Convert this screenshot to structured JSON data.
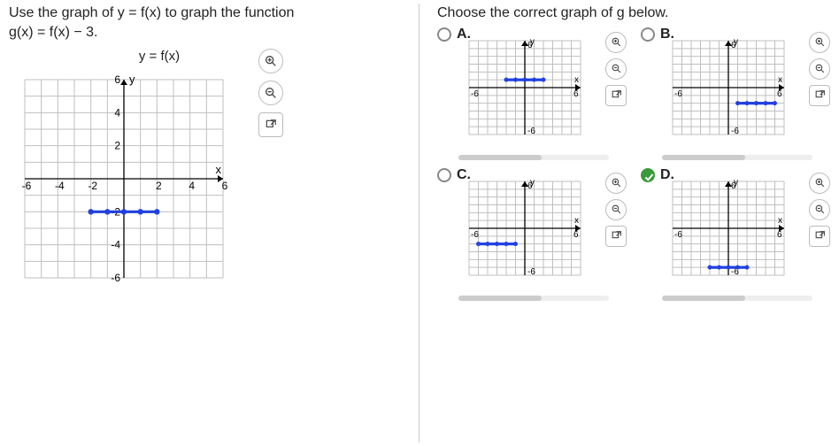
{
  "left": {
    "prompt_line1": "Use the graph of y = f(x) to graph the function",
    "prompt_line2": "g(x) = f(x) − 3.",
    "graph_title": "y = f(x)"
  },
  "right": {
    "prompt": "Choose the correct graph of g below.",
    "choices": {
      "A": {
        "label": "A."
      },
      "B": {
        "label": "B."
      },
      "C": {
        "label": "C."
      },
      "D": {
        "label": "D."
      }
    },
    "correct": "D"
  },
  "axis_labels": {
    "x": "x",
    "y": "y"
  },
  "icons": {
    "zoom_in": "zoom-in",
    "zoom_out": "zoom-out",
    "popout": "popout"
  },
  "chart_data": {
    "type": "line",
    "main": {
      "title": "y = f(x)",
      "xlabel": "x",
      "ylabel": "y",
      "xlim": [
        -6,
        6
      ],
      "ylim": [
        -6,
        6
      ],
      "x_ticks": [
        -6,
        -4,
        -2,
        2,
        4,
        6
      ],
      "y_ticks": [
        -6,
        -4,
        -2,
        2,
        4,
        6
      ],
      "series": [
        {
          "name": "f(x)",
          "x": [
            -2,
            -1,
            0,
            1,
            2
          ],
          "y": [
            -2,
            -2,
            -2,
            -2,
            -2
          ]
        }
      ]
    },
    "thumbnails": {
      "A": {
        "xlim": [
          -6,
          6
        ],
        "ylim": [
          -6,
          6
        ],
        "series": [
          {
            "name": "g",
            "x": [
              -2,
              -1,
              0,
              1,
              2
            ],
            "y": [
              1,
              1,
              1,
              1,
              1
            ]
          }
        ]
      },
      "B": {
        "xlim": [
          -6,
          6
        ],
        "ylim": [
          -6,
          6
        ],
        "series": [
          {
            "name": "g",
            "x": [
              1,
              2,
              3,
              4,
              5
            ],
            "y": [
              -2,
              -2,
              -2,
              -2,
              -2
            ]
          }
        ]
      },
      "C": {
        "xlim": [
          -6,
          6
        ],
        "ylim": [
          -6,
          6
        ],
        "series": [
          {
            "name": "g",
            "x": [
              -5,
              -4,
              -3,
              -2,
              -1
            ],
            "y": [
              -2,
              -2,
              -2,
              -2,
              -2
            ]
          }
        ]
      },
      "D": {
        "xlim": [
          -6,
          6
        ],
        "ylim": [
          -6,
          6
        ],
        "series": [
          {
            "name": "g",
            "x": [
              -2,
              -1,
              0,
              1,
              2
            ],
            "y": [
              -5,
              -5,
              -5,
              -5,
              -5
            ]
          }
        ]
      }
    }
  }
}
